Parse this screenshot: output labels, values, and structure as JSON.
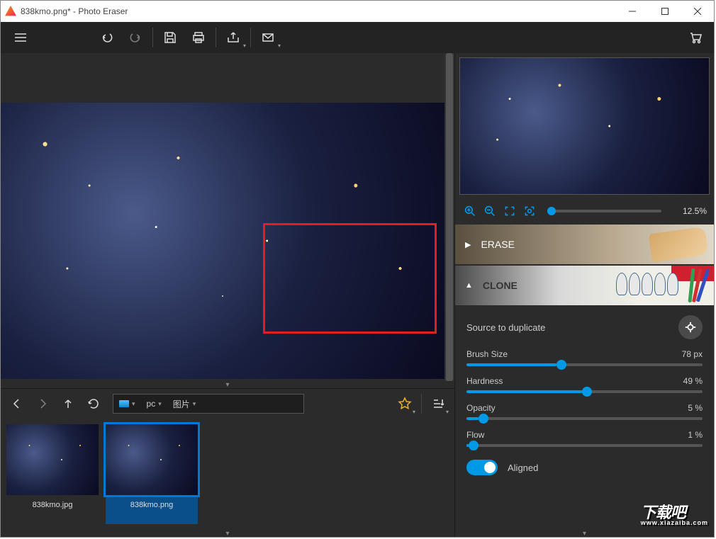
{
  "title": "838kmo.png* - Photo Eraser",
  "zoom": {
    "value": "12.5%"
  },
  "sections": {
    "erase": {
      "label": "ERASE"
    },
    "clone": {
      "label": "CLONE",
      "source_label": "Source to duplicate",
      "brush_size": {
        "label": "Brush Size",
        "value": "78 px",
        "pct": 38
      },
      "hardness": {
        "label": "Hardness",
        "value": "49 %",
        "pct": 49
      },
      "opacity": {
        "label": "Opacity",
        "value": "5 %",
        "pct": 5
      },
      "flow": {
        "label": "Flow",
        "value": "1 %",
        "pct": 1
      },
      "aligned": {
        "label": "Aligned",
        "on": true
      }
    }
  },
  "breadcrumb": {
    "seg1": "pc",
    "seg2": "图片"
  },
  "thumbs": [
    {
      "label": "838kmo.jpg",
      "selected": false
    },
    {
      "label": "838kmo.png",
      "selected": true
    }
  ],
  "watermark": {
    "big": "下载吧",
    "small": "www.xiazaiba.com"
  }
}
